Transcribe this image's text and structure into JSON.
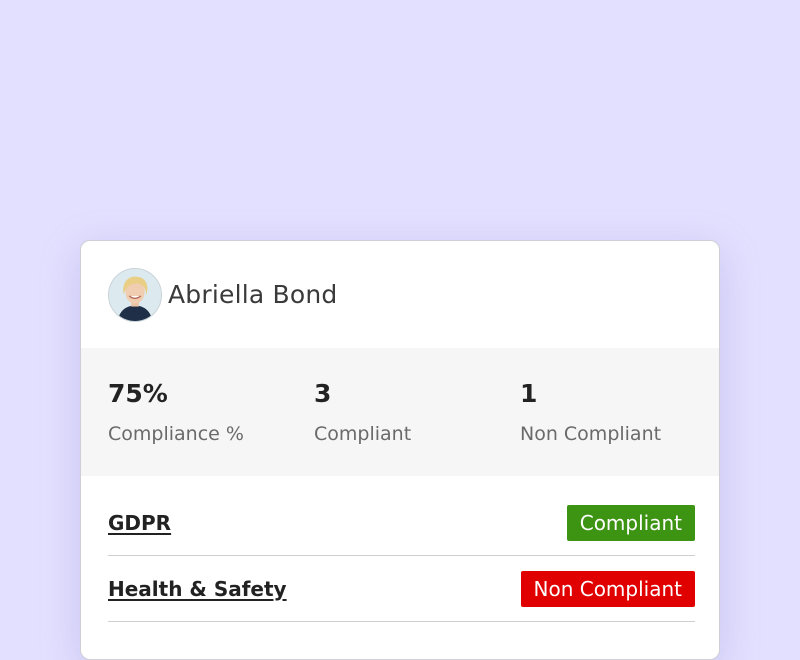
{
  "user": {
    "name": "Abriella Bond"
  },
  "stats": [
    {
      "value": "75%",
      "label": "Compliance %"
    },
    {
      "value": "3",
      "label": "Compliant"
    },
    {
      "value": "1",
      "label": "Non Compliant"
    }
  ],
  "policies": [
    {
      "name": "GDPR",
      "status": "Compliant",
      "status_color": "#3d9413"
    },
    {
      "name": "Health & Safety",
      "status": "Non Compliant",
      "status_color": "#e00000"
    }
  ]
}
